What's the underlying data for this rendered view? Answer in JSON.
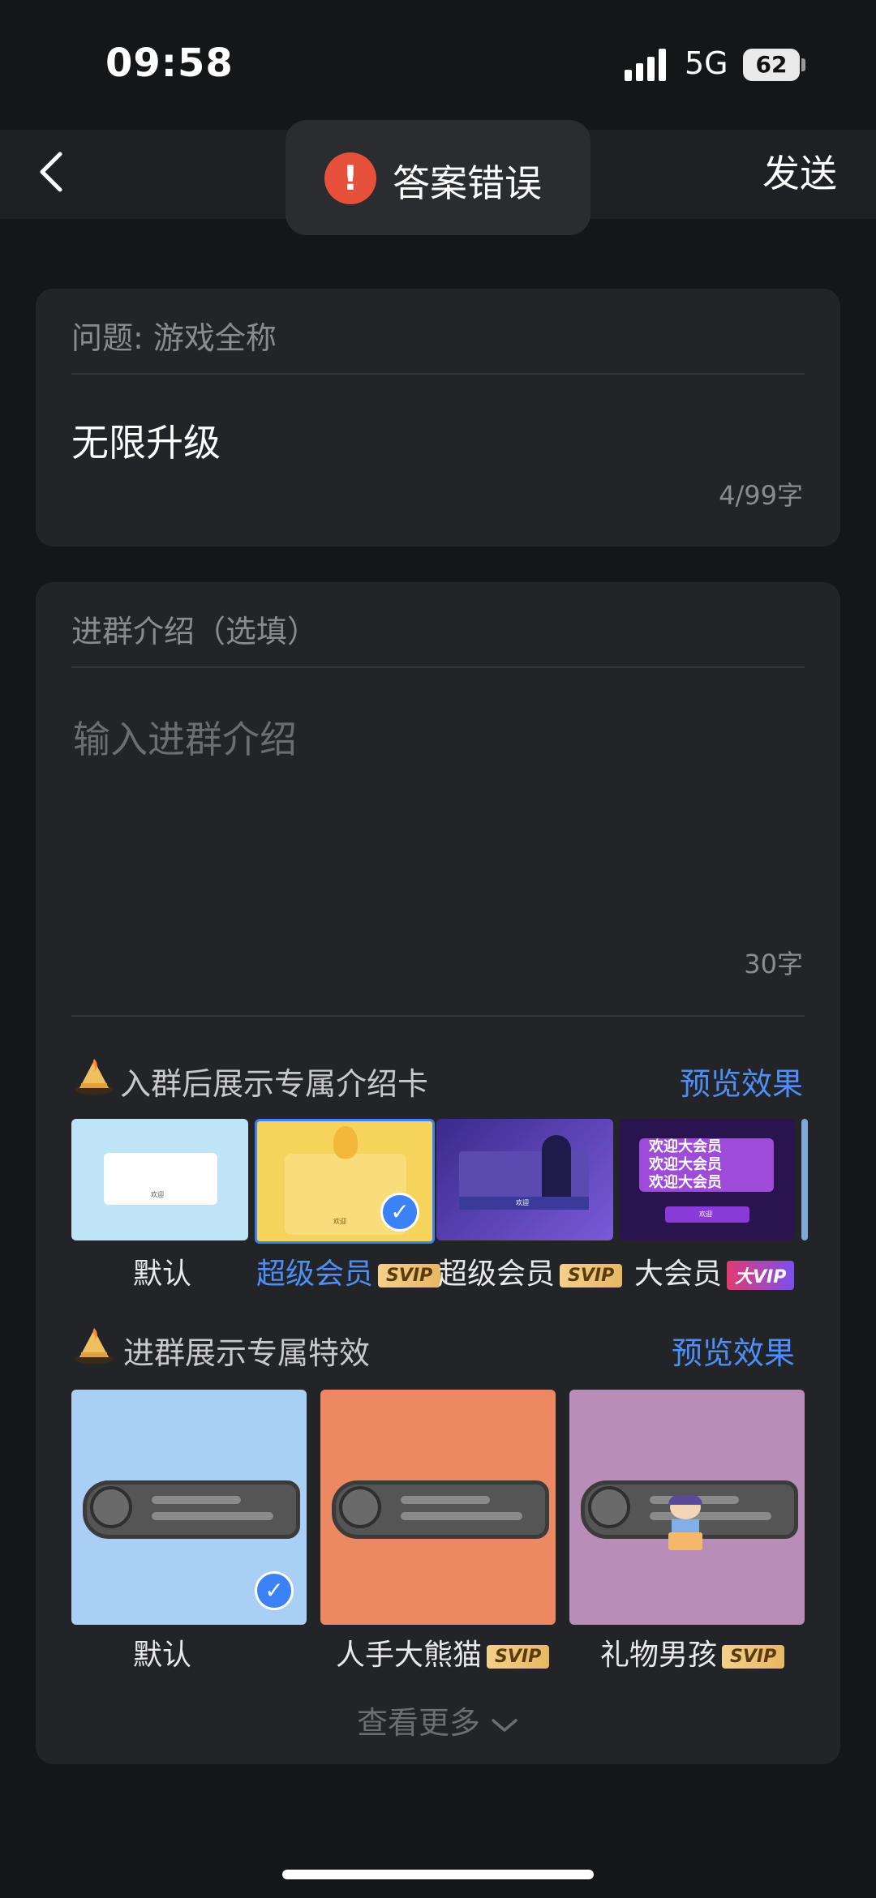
{
  "status": {
    "time": "09:58",
    "network": "5G",
    "battery": "62"
  },
  "nav": {
    "send_label": "发送"
  },
  "toast": {
    "text": "答案错误"
  },
  "question": {
    "label": "问题: 游戏全称",
    "answer": "无限升级",
    "count": "4/99字"
  },
  "intro": {
    "label": "进群介绍（选填）",
    "placeholder": "输入进群介绍",
    "count": "30字"
  },
  "card_section": {
    "title": "入群后展示专属介绍卡",
    "preview_label": "预览效果",
    "thumb_caption": "欢迎",
    "thumb_banner": "欢迎大会员",
    "options": [
      {
        "label": "默认",
        "badge": ""
      },
      {
        "label": "超级会员",
        "badge": "SVIP"
      },
      {
        "label": "超级会员",
        "badge": "SVIP"
      },
      {
        "label": "大会员",
        "badge": "大VIP"
      }
    ],
    "selected_index": 1
  },
  "effect_section": {
    "title": "进群展示专属特效",
    "preview_label": "预览效果",
    "options": [
      {
        "label": "默认",
        "badge": ""
      },
      {
        "label": "人手大熊猫",
        "badge": "SVIP"
      },
      {
        "label": "礼物男孩",
        "badge": "SVIP"
      }
    ],
    "selected_index": 0
  },
  "more_label": "查看更多",
  "colors": {
    "accent": "#4d8ff7",
    "toast_error": "#e5503a",
    "background": "#151618",
    "card": "#232428"
  }
}
